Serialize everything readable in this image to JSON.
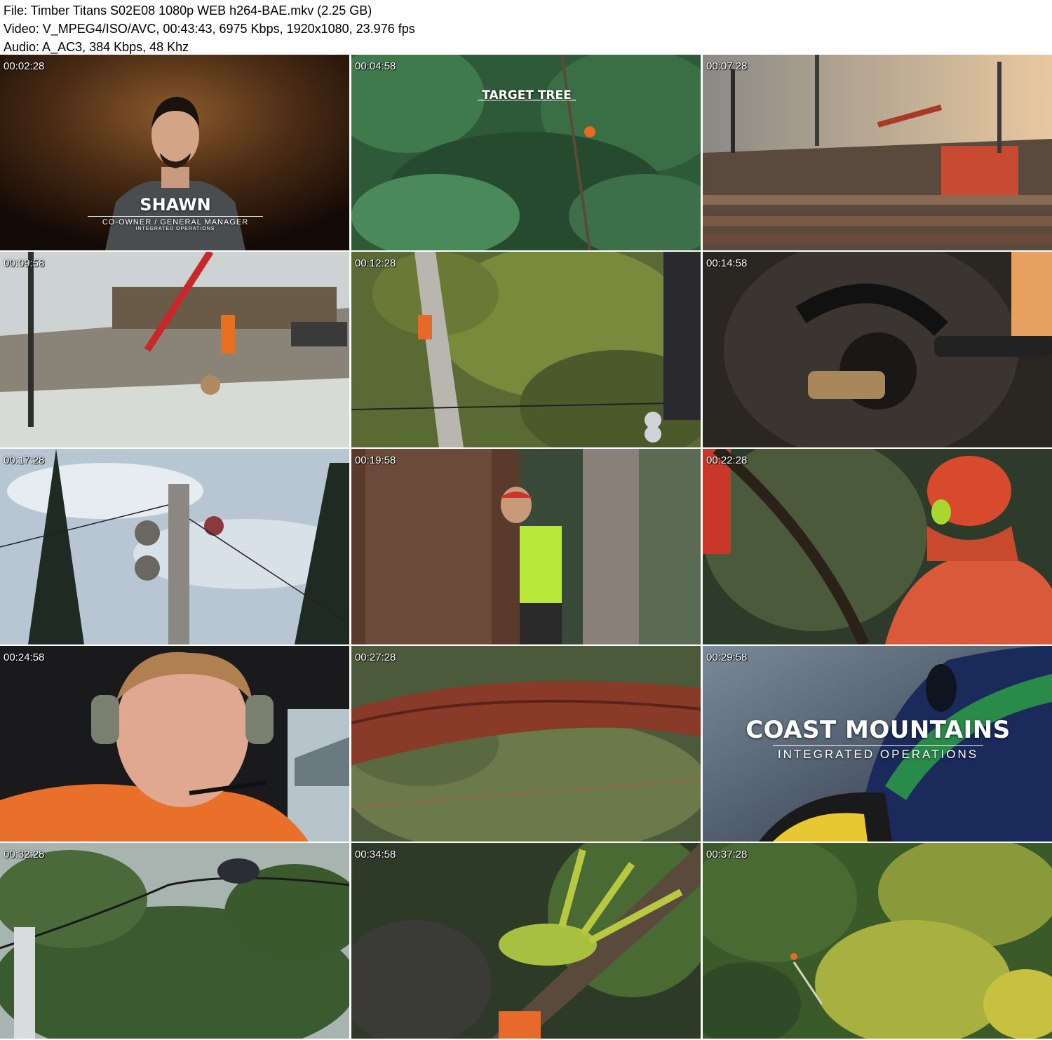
{
  "header": {
    "file_line": "File: Timber Titans S02E08 1080p WEB h264-BAE.mkv (2.25 GB)",
    "video_line": "Video: V_MPEG4/ISO/AVC, 00:43:43, 6975 Kbps, 1920x1080, 23.976 fps",
    "audio_line": "Audio: A_AC3, 384 Kbps, 48 Khz"
  },
  "thumbnails": [
    {
      "timestamp": "00:02:28",
      "overlay": {
        "name": "SHAWN",
        "role": "CO-OWNER / GENERAL MANAGER",
        "org": "INTEGRATED OPERATIONS"
      }
    },
    {
      "timestamp": "00:04:58",
      "overlay": {
        "label": "TARGET TREE"
      }
    },
    {
      "timestamp": "00:07:28"
    },
    {
      "timestamp": "00:09:58"
    },
    {
      "timestamp": "00:12:28"
    },
    {
      "timestamp": "00:14:58"
    },
    {
      "timestamp": "00:17:28"
    },
    {
      "timestamp": "00:19:58"
    },
    {
      "timestamp": "00:22:28"
    },
    {
      "timestamp": "00:24:58"
    },
    {
      "timestamp": "00:27:28"
    },
    {
      "timestamp": "00:29:58",
      "overlay": {
        "title": "COAST MOUNTAINS",
        "subtitle": "INTEGRATED OPERATIONS"
      }
    },
    {
      "timestamp": "00:32:28"
    },
    {
      "timestamp": "00:34:58"
    },
    {
      "timestamp": "00:37:28"
    }
  ]
}
